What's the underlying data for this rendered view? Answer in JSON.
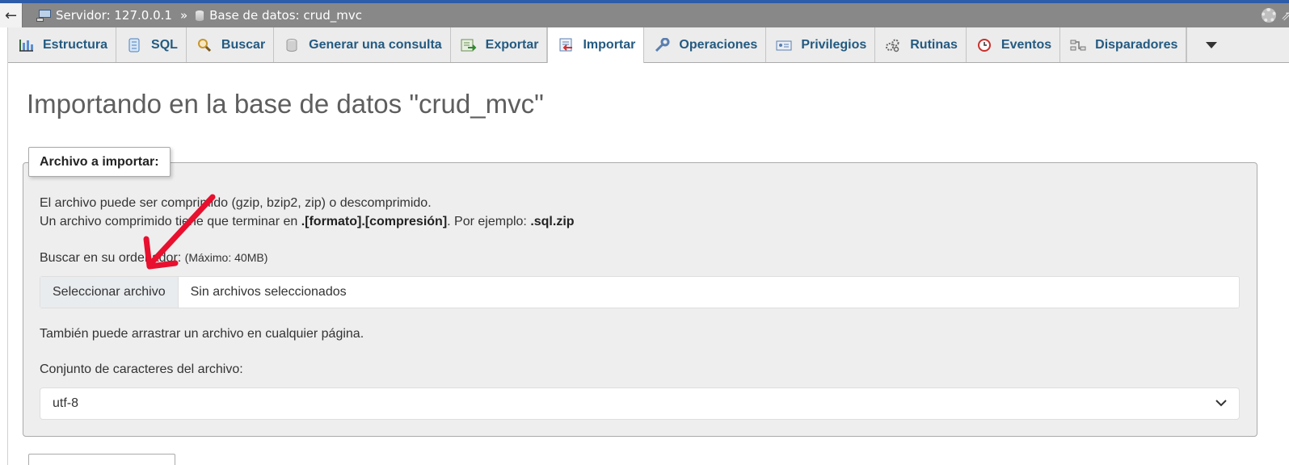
{
  "breadcrumb": {
    "back": "←",
    "server": "Servidor: 127.0.0.1",
    "separator": "»",
    "database": "Base de datos: crud_mvc",
    "edge": "⇗"
  },
  "tabs": [
    {
      "label": "Estructura",
      "icon": "structure-icon"
    },
    {
      "label": "SQL",
      "icon": "sql-icon"
    },
    {
      "label": "Buscar",
      "icon": "search-icon"
    },
    {
      "label": "Generar una consulta",
      "icon": "database-icon"
    },
    {
      "label": "Exportar",
      "icon": "export-icon"
    },
    {
      "label": "Importar",
      "icon": "import-icon",
      "active": true
    },
    {
      "label": "Operaciones",
      "icon": "wrench-icon"
    },
    {
      "label": "Privilegios",
      "icon": "privileges-icon"
    },
    {
      "label": "Rutinas",
      "icon": "routines-icon"
    },
    {
      "label": "Eventos",
      "icon": "clock-icon"
    },
    {
      "label": "Disparadores",
      "icon": "triggers-icon"
    }
  ],
  "page": {
    "title": "Importando en la base de datos \"crud_mvc\""
  },
  "import_section": {
    "legend": "Archivo a importar:",
    "info_line1": "El archivo puede ser comprimido (gzip, bzip2, zip) o descomprimido.",
    "info_line2_pre": "Un archivo comprimido tiene que terminar en ",
    "info_line2_bold": ".[formato].[compresión]",
    "info_line2_mid": ". Por ejemplo: ",
    "info_line2_example": ".sql.zip",
    "browse_label": "Buscar en su ordenador:",
    "browse_max": "(Máximo: 40MB)",
    "file_button": "Seleccionar archivo",
    "file_status": "Sin archivos seleccionados",
    "drag_hint": "También puede arrastrar un archivo en cualquier página.",
    "charset_label": "Conjunto de caracteres del archivo:",
    "charset_value": "utf-8"
  },
  "colors": {
    "accent": "#235a81",
    "topbar": "#888888",
    "annotation_arrow": "#e8102e"
  }
}
